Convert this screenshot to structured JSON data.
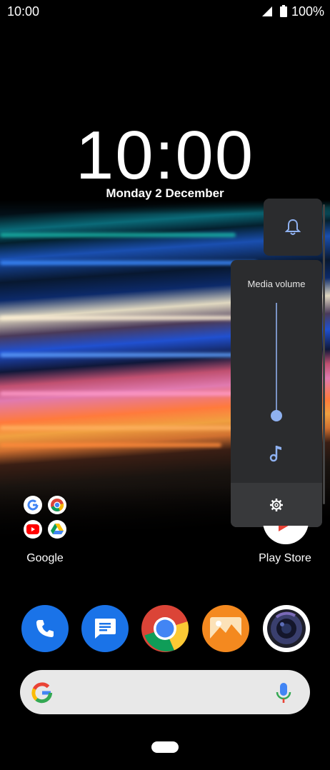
{
  "status_bar": {
    "time": "10:00",
    "battery_pct": "100%"
  },
  "lock": {
    "clock": "10:00",
    "date": "Monday 2 December"
  },
  "volume": {
    "title": "Media volume",
    "level_fraction": 0.0,
    "ring_icon": "bell-icon",
    "stream_icon": "music-note-icon",
    "settings_icon": "gear-icon",
    "accent": "#8fb1f0"
  },
  "home": {
    "folder_label": "Google",
    "play_store_label": "Play Store"
  },
  "dock": [
    {
      "name": "phone",
      "icon": "phone-icon",
      "color": "#1a73e8"
    },
    {
      "name": "messages",
      "icon": "messages-icon",
      "color": "#1a73e8"
    },
    {
      "name": "chrome",
      "icon": "chrome-icon",
      "color": "#ffffff"
    },
    {
      "name": "gallery",
      "icon": "gallery-icon",
      "color": "#f4891f"
    },
    {
      "name": "camera",
      "icon": "camera-icon",
      "color": "#ffffff"
    }
  ],
  "search": {
    "logo": "google-g-icon",
    "mic": "mic-icon"
  }
}
